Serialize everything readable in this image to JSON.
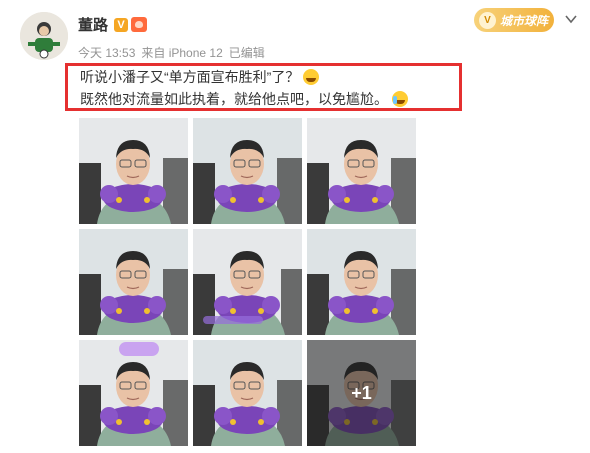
{
  "post": {
    "author_name": "董路",
    "time": "今天 13:53",
    "source": "来自 iPhone 12",
    "edited": "已编辑",
    "vip_tag": "城市球阵",
    "vip_icon": "V",
    "verified_badge": "V",
    "text_line1": "听说小潘子又“单方面宣布胜利”了？",
    "text_line2": "既然他对流量如此执着，就给他点吧，以免尴尬。"
  },
  "photos": [
    {
      "id": 1
    },
    {
      "id": 2
    },
    {
      "id": 3
    },
    {
      "id": 4
    },
    {
      "id": 5
    },
    {
      "id": 6
    },
    {
      "id": 7
    },
    {
      "id": 8
    },
    {
      "id": 9,
      "more": "+1"
    }
  ],
  "icons": {
    "chevron": "chevron-down-icon",
    "laugh_emoji": "laughing-emoji-icon",
    "cry_emoji": "crying-laughing-emoji-icon"
  },
  "colors": {
    "highlight": "#e53030",
    "vip_gold": "#f2b13b",
    "verified": "#f5a623"
  }
}
